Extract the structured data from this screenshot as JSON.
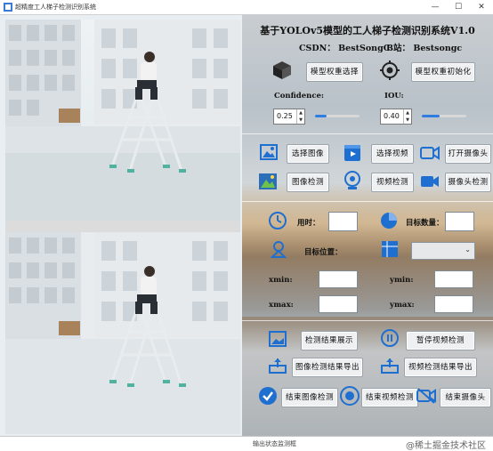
{
  "window": {
    "title": "超精度工人梯子检测识别系统",
    "min_glyph": "—",
    "max_glyph": "☐",
    "close_glyph": "✕"
  },
  "header": {
    "title": "基于YOLOv5模型的工人梯子检测识别系统V1.0",
    "csdn": "CSDN： BestSongC",
    "bilibili": "B站： Bestsongc"
  },
  "model": {
    "select_label": "模型权重选择",
    "init_label": "模型权重初始化",
    "select_icon": "cube-icon",
    "init_icon": "target-icon"
  },
  "params": {
    "confidence_label": "Confidence:",
    "iou_label": "IOU:",
    "confidence_value": "0.25",
    "iou_value": "0.40",
    "confidence_fraction": 0.25,
    "iou_fraction": 0.4
  },
  "actions": {
    "select_image": "选择图像",
    "select_video": "选择视频",
    "open_camera": "打开摄像头",
    "image_detect": "图像检测",
    "video_detect": "视频检测",
    "camera_detect": "摄像头检测"
  },
  "results": {
    "time_label": "用时：",
    "count_label": "目标数量：",
    "target_label": "目标位置：",
    "xmin_label": "xmin:",
    "ymin_label": "ymin:",
    "xmax_label": "xmax:",
    "ymax_label": "ymax:",
    "time_value": "",
    "count_value": "",
    "xmin_value": "",
    "ymin_value": "",
    "xmax_value": "",
    "ymax_value": "",
    "target_select": ""
  },
  "controls": {
    "show_results": "检测结果展示",
    "pause_video": "暂停视频检测",
    "export_image": "图像检测结果导出",
    "export_video": "视频检测结果导出",
    "end_image": "结束图像检测",
    "end_video": "结束视频检测",
    "end_camera": "结束摄像头"
  },
  "statusbar": {
    "text": "输出状态监测框",
    "watermark": "@稀土掘金技术社区"
  },
  "colors": {
    "accent_blue": "#2f7de1",
    "icon_blue": "#1f6fd0"
  }
}
